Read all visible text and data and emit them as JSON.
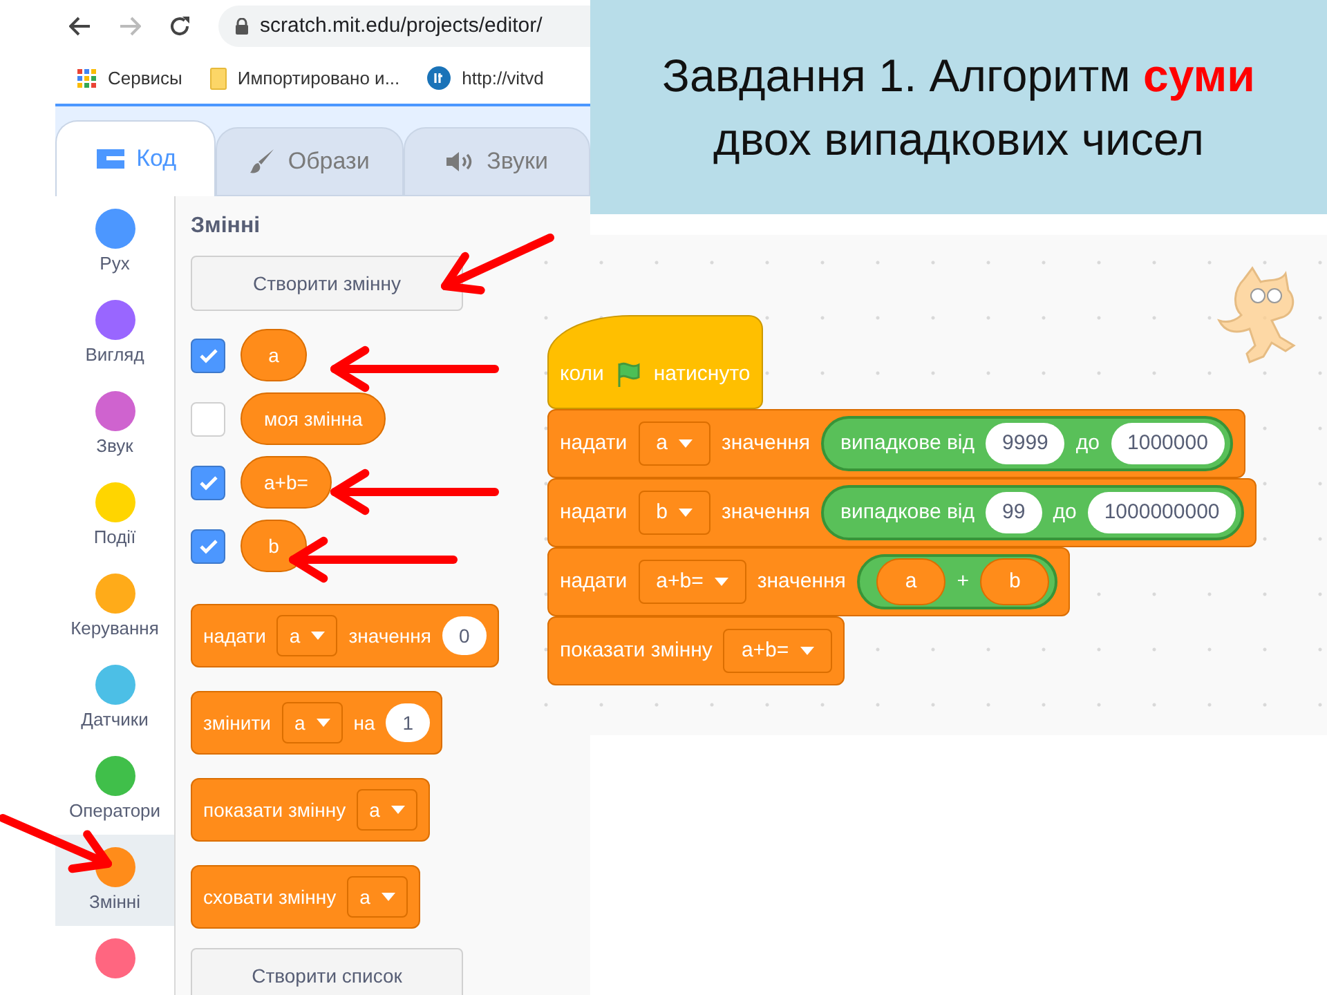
{
  "browser": {
    "address": "scratch.mit.edu/projects/editor/",
    "bookmarks": [
      {
        "kind": "apps",
        "label": "Сервисы"
      },
      {
        "kind": "folder",
        "label": "Импортировано и..."
      },
      {
        "kind": "site",
        "label": "http://vitvd"
      }
    ]
  },
  "tabs": [
    {
      "kind": "code",
      "label": "Код",
      "selected": true
    },
    {
      "kind": "costumes",
      "label": "Образи",
      "selected": false
    },
    {
      "kind": "sounds",
      "label": "Звуки",
      "selected": false
    }
  ],
  "categories": [
    {
      "label": "Рух",
      "color": "#4c97ff",
      "selected": false
    },
    {
      "label": "Вигляд",
      "color": "#9966ff",
      "selected": false
    },
    {
      "label": "Звук",
      "color": "#cf63cf",
      "selected": false
    },
    {
      "label": "Події",
      "color": "#ffd500",
      "selected": false
    },
    {
      "label": "Керування",
      "color": "#ffab19",
      "selected": false
    },
    {
      "label": "Датчики",
      "color": "#4cbfe6",
      "selected": false
    },
    {
      "label": "Оператори",
      "color": "#40bf4a",
      "selected": false
    },
    {
      "label": "Змінні",
      "color": "#ff8c1a",
      "selected": true
    },
    {
      "color": "#ff6680",
      "selected": false
    }
  ],
  "palette": {
    "heading": "Змінні",
    "create_variable": "Створити змінну",
    "variables": [
      {
        "name": "a",
        "checked": true
      },
      {
        "name": "моя змінна",
        "checked": false
      },
      {
        "name": "a+b=",
        "checked": true
      },
      {
        "name": "b",
        "checked": true
      }
    ],
    "blocks": [
      [
        {
          "kind": "text",
          "text": "надати"
        },
        {
          "kind": "dropdown",
          "text": "a"
        },
        {
          "kind": "text",
          "text": "значення"
        },
        {
          "kind": "number",
          "text": "0"
        }
      ],
      [
        {
          "kind": "text",
          "text": "змінити"
        },
        {
          "kind": "dropdown",
          "text": "a"
        },
        {
          "kind": "text",
          "text": "на"
        },
        {
          "kind": "number",
          "text": "1"
        }
      ],
      [
        {
          "kind": "text",
          "text": "показати змінну"
        },
        {
          "kind": "dropdown",
          "text": "a"
        }
      ],
      [
        {
          "kind": "text",
          "text": "сховати змінну"
        },
        {
          "kind": "dropdown",
          "text": "a"
        }
      ]
    ],
    "create_list": "Створити список"
  },
  "title": {
    "lines": [
      "Завдання 1. Алгоритм **суми**",
      "двох випадкових чисел"
    ]
  },
  "script": {
    "hat": [
      {
        "kind": "text",
        "text": "коли"
      },
      {
        "kind": "flag"
      },
      {
        "kind": "text",
        "text": "натиснуто"
      }
    ],
    "blocks": [
      [
        {
          "kind": "text",
          "text": "надати"
        },
        {
          "kind": "dropdown",
          "text": "a"
        },
        {
          "kind": "text",
          "text": "значення"
        },
        {
          "kind": "reporter",
          "parts": [
            {
              "kind": "text",
              "text": "випадкове від"
            },
            {
              "kind": "number",
              "text": "9999"
            },
            {
              "kind": "text",
              "text": "до"
            },
            {
              "kind": "number",
              "text": "1000000"
            }
          ]
        }
      ],
      [
        {
          "kind": "text",
          "text": "надати"
        },
        {
          "kind": "dropdown",
          "text": "b"
        },
        {
          "kind": "text",
          "text": "значення"
        },
        {
          "kind": "reporter",
          "parts": [
            {
              "kind": "text",
              "text": "випадкове від"
            },
            {
              "kind": "number",
              "text": "99"
            },
            {
              "kind": "text",
              "text": "до"
            },
            {
              "kind": "number",
              "text": "1000000000"
            }
          ]
        }
      ],
      [
        {
          "kind": "text",
          "text": "надати"
        },
        {
          "kind": "dropdown",
          "text": "a+b="
        },
        {
          "kind": "text",
          "text": "значення"
        },
        {
          "kind": "reporter",
          "parts": [
            {
              "kind": "variable",
              "text": "a"
            },
            {
              "kind": "text",
              "text": "+"
            },
            {
              "kind": "variable",
              "text": "b"
            }
          ]
        }
      ],
      [
        {
          "kind": "text",
          "text": "показати змінну"
        },
        {
          "kind": "dropdown",
          "text": "a+b="
        }
      ]
    ]
  }
}
